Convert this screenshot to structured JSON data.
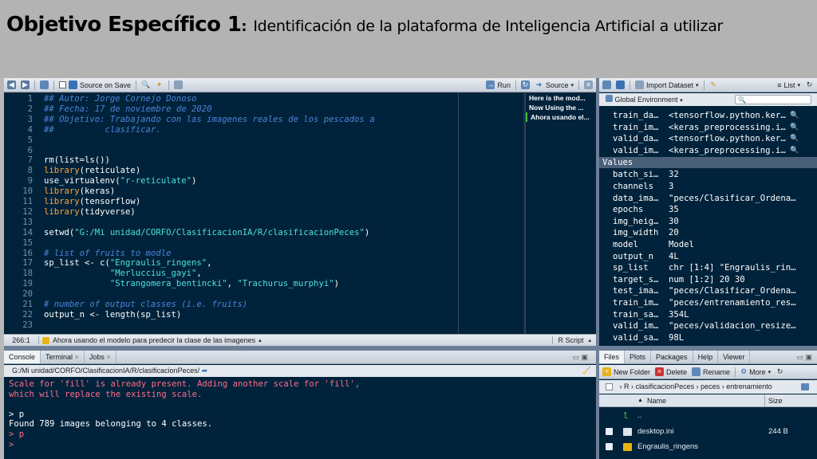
{
  "slide": {
    "title_main": "Objetivo Específico 1",
    "title_colon": ":",
    "title_sub": "Identificación de la plataforma de Inteligencia Artificial a utilizar"
  },
  "editor": {
    "toolbar": {
      "source_on_save": "Source on Save",
      "run": "Run",
      "source": "Source"
    },
    "lines": [
      {
        "n": "1",
        "t": "## Autor: Jorge Cornejo Donoso"
      },
      {
        "n": "2",
        "t": "## Fecha: 17 de noviembre de 2020"
      },
      {
        "n": "3",
        "t": "## Objetivo: Trabajando con las imagenes reales de los pescados a"
      },
      {
        "n": "4",
        "t": "##          clasificar."
      },
      {
        "n": "5",
        "t": ""
      },
      {
        "n": "6",
        "t": ""
      },
      {
        "n": "7",
        "t": "rm(list=ls())"
      },
      {
        "n": "8",
        "t": "library(reticulate)"
      },
      {
        "n": "9",
        "t": "use_virtualenv(\"r-reticulate\")"
      },
      {
        "n": "10",
        "t": "library(keras)"
      },
      {
        "n": "11",
        "t": "library(tensorflow)"
      },
      {
        "n": "12",
        "t": "library(tidyverse)"
      },
      {
        "n": "13",
        "t": ""
      },
      {
        "n": "14",
        "t": "setwd(\"G:/Mi unidad/CORFO/ClasificacionIA/R/clasificacionPeces\")"
      },
      {
        "n": "15",
        "t": ""
      },
      {
        "n": "16",
        "t": "# list of fruits to modle"
      },
      {
        "n": "17",
        "t": "sp_list <- c(\"Engraulis_ringens\","
      },
      {
        "n": "18",
        "t": "             \"Merluccius_gayi\","
      },
      {
        "n": "19",
        "t": "             \"Strangomera_bentincki\", \"Trachurus_murphyi\")"
      },
      {
        "n": "20",
        "t": ""
      },
      {
        "n": "21",
        "t": "# number of output classes (i.e. fruits)"
      },
      {
        "n": "22",
        "t": "output_n <- length(sp_list)"
      },
      {
        "n": "23",
        "t": ""
      }
    ],
    "outline": [
      "Here is the mod...",
      "Now Using the ...",
      "Ahora usando el..."
    ],
    "status": {
      "position": "266:1",
      "section": "Ahora usando el modelo para predecir la clase de las imagenes",
      "filetype": "R Script"
    }
  },
  "console": {
    "tabs": [
      "Console",
      "Terminal",
      "Jobs"
    ],
    "path": "G:/Mi unidad/CORFO/ClasificacionIA/R/clasificacionPeces/",
    "lines": [
      {
        "cls": "err",
        "t": "Scale for 'fill' is already present. Adding another scale for 'fill',"
      },
      {
        "cls": "err",
        "t": "which will replace the existing scale."
      },
      {
        "cls": "pl",
        "t": ""
      },
      {
        "cls": "pl",
        "t": "> p"
      },
      {
        "cls": "pl",
        "t": "Found 789 images belonging to 4 classes."
      },
      {
        "cls": "prompt",
        "t": "> p"
      },
      {
        "cls": "prompt",
        "t": "> "
      }
    ]
  },
  "environment": {
    "toolbar": {
      "import": "Import Dataset",
      "list": "List"
    },
    "scope": "Global Environment",
    "data_rows": [
      {
        "name": "train_da…",
        "value": "<tensorflow.python.ker…"
      },
      {
        "name": "train_im…",
        "value": "<keras_preprocessing.i…"
      },
      {
        "name": "valid_da…",
        "value": "<tensorflow.python.ker…"
      },
      {
        "name": "valid_im…",
        "value": "<keras_preprocessing.i…"
      }
    ],
    "values_header": "Values",
    "value_rows": [
      {
        "name": "batch_si…",
        "value": "32"
      },
      {
        "name": "channels",
        "value": "3"
      },
      {
        "name": "data_ima…",
        "value": "\"peces/Clasificar_Ordena…"
      },
      {
        "name": "epochs",
        "value": "35"
      },
      {
        "name": "img_heig…",
        "value": "30"
      },
      {
        "name": "img_width",
        "value": "20"
      },
      {
        "name": "model",
        "value": "Model"
      },
      {
        "name": "output_n",
        "value": "4L"
      },
      {
        "name": "sp_list",
        "value": "chr [1:4] \"Engraulis_rin…"
      },
      {
        "name": "target_s…",
        "value": "num [1:2] 20 30"
      },
      {
        "name": "test_ima…",
        "value": "\"peces/Clasificar_Ordena…"
      },
      {
        "name": "train_im…",
        "value": "\"peces/entrenamiento_res…"
      },
      {
        "name": "train_sa…",
        "value": "354L"
      },
      {
        "name": "valid_im…",
        "value": "\"peces/validacion_resize…"
      },
      {
        "name": "valid_sa…",
        "value": "98L"
      }
    ]
  },
  "files": {
    "tabs": [
      "Files",
      "Plots",
      "Packages",
      "Help",
      "Viewer"
    ],
    "toolbar": {
      "new_folder": "New Folder",
      "delete": "Delete",
      "rename": "Rename",
      "more": "More"
    },
    "breadcrumb": [
      "R",
      "clasificacionPeces",
      "peces",
      "entrenamiento"
    ],
    "columns": {
      "name": "Name",
      "size": "Size"
    },
    "rows": [
      {
        "name": "..",
        "size": ""
      },
      {
        "name": "desktop.ini",
        "size": "244 B"
      },
      {
        "name": "Engraulis_ringens",
        "size": ""
      }
    ]
  }
}
